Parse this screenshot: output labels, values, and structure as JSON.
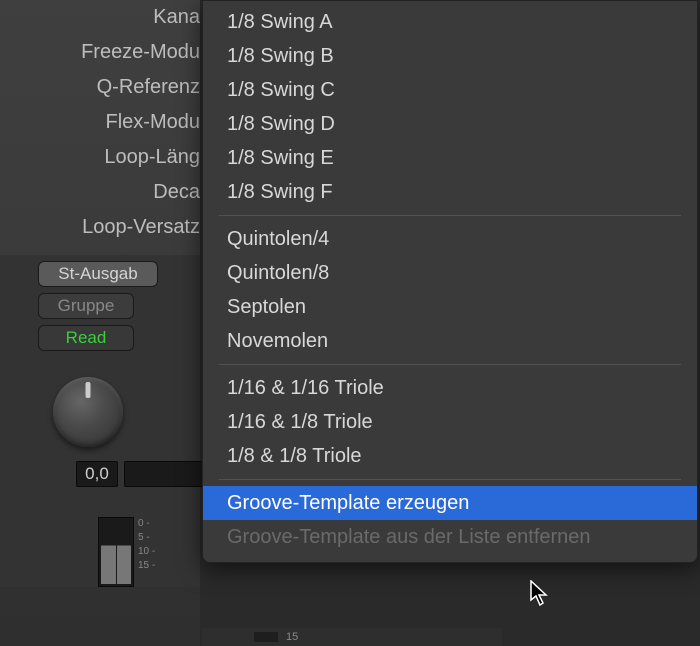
{
  "params": {
    "kana": "Kana",
    "freeze": "Freeze-Modu",
    "qref": "Q-Referenz",
    "flex": "Flex-Modu",
    "looplen": "Loop-Läng",
    "decay": "Deca",
    "loopoffset": "Loop-Versatz"
  },
  "buttons": {
    "stausgab": "St-Ausgab",
    "gruppe": "Gruppe",
    "read": "Read"
  },
  "value": "0,0",
  "ticks": [
    "0 -",
    "5 -",
    "10 -",
    "15 -"
  ],
  "menu": {
    "group1": [
      "1/8 Swing A",
      "1/8 Swing B",
      "1/8 Swing C",
      "1/8 Swing D",
      "1/8 Swing E",
      "1/8 Swing F"
    ],
    "group2": [
      "Quintolen/4",
      "Quintolen/8",
      "Septolen",
      "Novemolen"
    ],
    "group3": [
      "1/16 & 1/16 Triole",
      "1/16 & 1/8 Triole",
      "1/8 & 1/8 Triole"
    ],
    "create": "Groove-Template erzeugen",
    "remove": "Groove-Template aus der Liste entfernen"
  },
  "bottom_tick": "15"
}
